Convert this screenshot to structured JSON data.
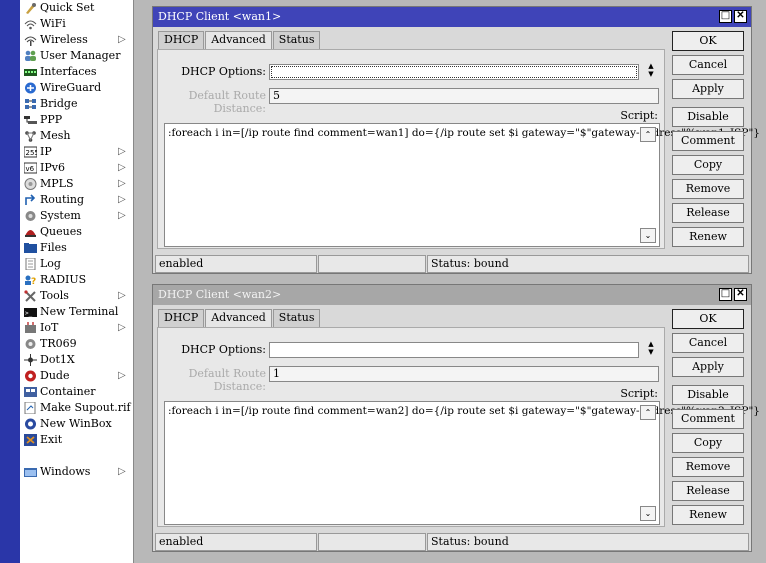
{
  "menu": {
    "items": [
      {
        "label": "Quick Set",
        "icon": "quick-set-icon",
        "arrow": false
      },
      {
        "label": "WiFi",
        "icon": "wifi-icon",
        "arrow": false
      },
      {
        "label": "Wireless",
        "icon": "wireless-icon",
        "arrow": true
      },
      {
        "label": "User Manager",
        "icon": "user-manager-icon",
        "arrow": false
      },
      {
        "label": "Interfaces",
        "icon": "interfaces-icon",
        "arrow": false
      },
      {
        "label": "WireGuard",
        "icon": "wireguard-icon",
        "arrow": false
      },
      {
        "label": "Bridge",
        "icon": "bridge-icon",
        "arrow": false
      },
      {
        "label": "PPP",
        "icon": "ppp-icon",
        "arrow": false
      },
      {
        "label": "Mesh",
        "icon": "mesh-icon",
        "arrow": false
      },
      {
        "label": "IP",
        "icon": "ip-icon",
        "arrow": true
      },
      {
        "label": "IPv6",
        "icon": "ipv6-icon",
        "arrow": true
      },
      {
        "label": "MPLS",
        "icon": "mpls-icon",
        "arrow": true
      },
      {
        "label": "Routing",
        "icon": "routing-icon",
        "arrow": true
      },
      {
        "label": "System",
        "icon": "system-icon",
        "arrow": true
      },
      {
        "label": "Queues",
        "icon": "queues-icon",
        "arrow": false
      },
      {
        "label": "Files",
        "icon": "files-icon",
        "arrow": false
      },
      {
        "label": "Log",
        "icon": "log-icon",
        "arrow": false
      },
      {
        "label": "RADIUS",
        "icon": "radius-icon",
        "arrow": false
      },
      {
        "label": "Tools",
        "icon": "tools-icon",
        "arrow": true
      },
      {
        "label": "New Terminal",
        "icon": "terminal-icon",
        "arrow": false
      },
      {
        "label": "IoT",
        "icon": "iot-icon",
        "arrow": true
      },
      {
        "label": "TR069",
        "icon": "tr069-icon",
        "arrow": false
      },
      {
        "label": "Dot1X",
        "icon": "dot1x-icon",
        "arrow": false
      },
      {
        "label": "Dude",
        "icon": "dude-icon",
        "arrow": true
      },
      {
        "label": "Container",
        "icon": "container-icon",
        "arrow": false
      },
      {
        "label": "Make Supout.rif",
        "icon": "supout-icon",
        "arrow": false
      },
      {
        "label": "New WinBox",
        "icon": "winbox-icon",
        "arrow": false
      },
      {
        "label": "Exit",
        "icon": "exit-icon",
        "arrow": false
      }
    ],
    "windows_item": {
      "label": "Windows",
      "icon": "windows-icon",
      "arrow": true
    },
    "arrow_glyph": "▷"
  },
  "windows": [
    {
      "title": "DHCP Client <wan1>",
      "active": true,
      "tabs": [
        "DHCP",
        "Advanced",
        "Status"
      ],
      "active_tab": "Advanced",
      "dhcp_options_label": "DHCP Options:",
      "dhcp_options_value": "",
      "default_route_distance_label": "Default Route Distance:",
      "default_route_distance_value": "5",
      "script_label": "Script:",
      "script_value": ":foreach i in=[/ip route find comment=wan1] do={/ip route set $i gateway=\"$\"gateway-address\"%wan1_ISP\"}",
      "buttons": [
        "OK",
        "Cancel",
        "Apply",
        "Disable",
        "Comment",
        "Copy",
        "Remove",
        "Release",
        "Renew"
      ],
      "status": {
        "enabled": "enabled",
        "middle": "",
        "bound": "Status: bound"
      }
    },
    {
      "title": "DHCP Client <wan2>",
      "active": false,
      "tabs": [
        "DHCP",
        "Advanced",
        "Status"
      ],
      "active_tab": "Advanced",
      "dhcp_options_label": "DHCP Options:",
      "dhcp_options_value": "",
      "default_route_distance_label": "Default Route Distance:",
      "default_route_distance_value": "1",
      "script_label": "Script:",
      "script_value": ":foreach i in=[/ip route find comment=wan2] do={/ip route set $i gateway=\"$\"gateway-address\"%wan2_ISP\"}",
      "buttons": [
        "OK",
        "Cancel",
        "Apply",
        "Disable",
        "Comment",
        "Copy",
        "Remove",
        "Release",
        "Renew"
      ],
      "status": {
        "enabled": "enabled",
        "middle": "",
        "bound": "Status: bound"
      }
    }
  ],
  "colors": {
    "sidebar_strip": "#2a36a8",
    "active_title": "#3f44b8",
    "inactive_title": "#a7a7a7",
    "background": "#b8b8b8"
  }
}
